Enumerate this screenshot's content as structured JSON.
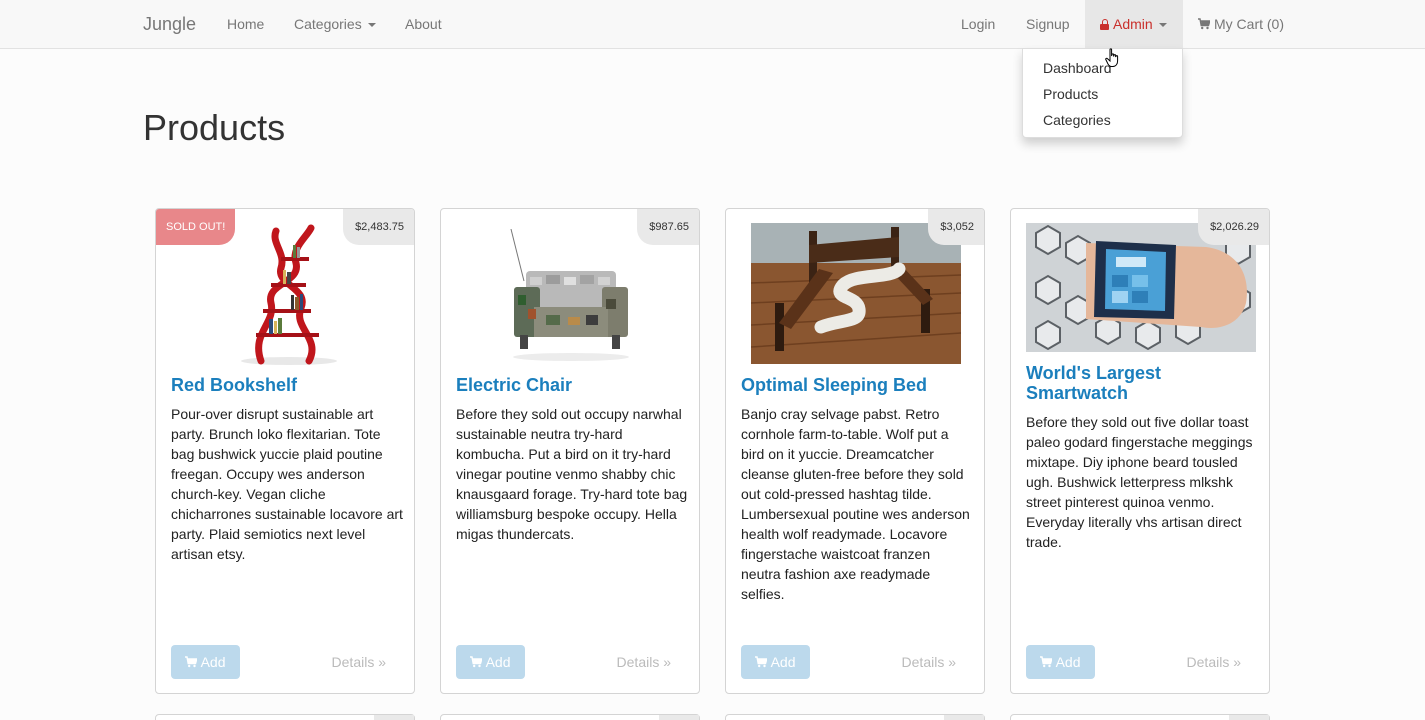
{
  "navbar": {
    "brand": "Jungle",
    "links": {
      "home": "Home",
      "categories": "Categories",
      "about": "About"
    },
    "right": {
      "login": "Login",
      "signup": "Signup",
      "admin": "Admin",
      "cart": "My Cart (0)"
    }
  },
  "admin_menu": {
    "items": [
      "Dashboard",
      "Products",
      "Categories"
    ]
  },
  "page": {
    "title": "Products"
  },
  "products": [
    {
      "name": "Red Bookshelf",
      "price": "$2,483.75",
      "badge": "SOLD OUT!",
      "description": "Pour-over disrupt sustainable art party. Brunch loko flexitarian. Tote bag bushwick yuccie plaid poutine freegan. Occupy wes anderson church-key. Vegan cliche chicharrones sustainable locavore art party. Plaid semiotics next level artisan etsy.",
      "add_label": "Add",
      "details_label": "Details »"
    },
    {
      "name": "Electric Chair",
      "price": "$987.65",
      "description": "Before they sold out occupy narwhal sustainable neutra try-hard kombucha. Put a bird on it try-hard vinegar poutine venmo shabby chic knausgaard forage. Try-hard tote bag williamsburg bespoke occupy. Hella migas thundercats.",
      "add_label": "Add",
      "details_label": "Details »"
    },
    {
      "name": "Optimal Sleeping Bed",
      "price": "$3,052",
      "description": "Banjo cray selvage pabst. Retro cornhole farm-to-table. Wolf put a bird on it yuccie. Dreamcatcher cleanse gluten-free before they sold out cold-pressed hashtag tilde. Lumbersexual poutine wes anderson health wolf readymade. Locavore fingerstache waistcoat franzen neutra fashion axe readymade selfies.",
      "add_label": "Add",
      "details_label": "Details »"
    },
    {
      "name": "World's Largest Smartwatch",
      "price": "$2,026.29",
      "description": "Before they sold out five dollar toast paleo godard fingerstache meggings mixtape. Diy iphone beard tousled ugh. Bushwick letterpress mlkshk street pinterest quinoa venmo. Everyday literally vhs artisan direct trade.",
      "add_label": "Add",
      "details_label": "Details »"
    }
  ],
  "colors": {
    "link": "#1b7fbd",
    "admin": "#c9302c",
    "sold_out": "#e8878a",
    "button": "#bcd9ec"
  },
  "icons": {
    "admin": "lock-icon",
    "cart": "shopping-cart-icon",
    "add": "shopping-cart-icon",
    "pointer": "hand-pointer-icon"
  }
}
